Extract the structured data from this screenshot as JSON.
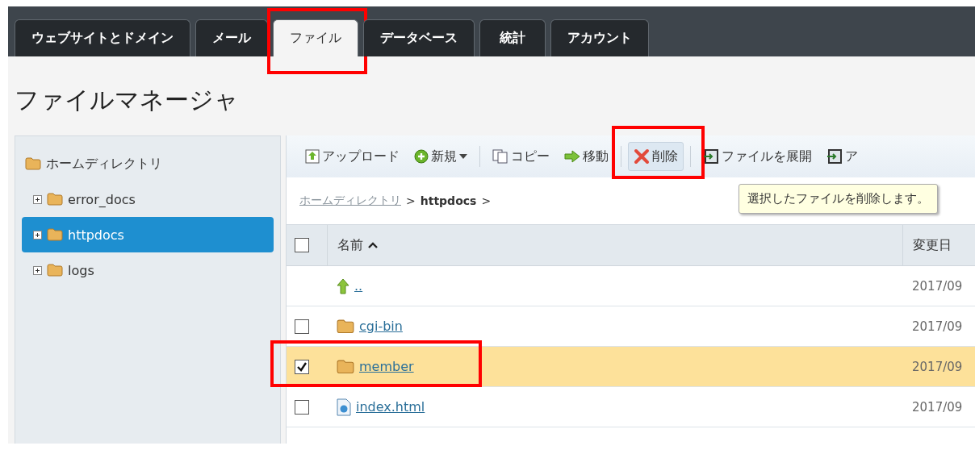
{
  "tabs": [
    {
      "label": "ウェブサイトとドメイン",
      "selected": false,
      "highlighted": false
    },
    {
      "label": "メール",
      "selected": false,
      "highlighted": false
    },
    {
      "label": "ファイル",
      "selected": true,
      "highlighted": true
    },
    {
      "label": "データベース",
      "selected": false,
      "highlighted": false
    },
    {
      "label": "統計",
      "selected": false,
      "highlighted": false
    },
    {
      "label": "アカウント",
      "selected": false,
      "highlighted": false
    }
  ],
  "page_title": "ファイルマネージャ",
  "tree": {
    "label": "ホームディレクトリ",
    "children": [
      {
        "label": "error_docs",
        "selected": false
      },
      {
        "label": "httpdocs",
        "selected": true
      },
      {
        "label": "logs",
        "selected": false
      }
    ]
  },
  "toolbar": [
    [
      {
        "kind": "upload",
        "label": "アップロード",
        "hovered": false,
        "highlighted": false
      },
      {
        "kind": "new",
        "label": "新規",
        "hovered": false,
        "highlighted": false
      }
    ],
    [
      {
        "kind": "copy",
        "label": "コピー",
        "hovered": false,
        "highlighted": false
      },
      {
        "kind": "move",
        "label": "移動",
        "hovered": false,
        "highlighted": false
      }
    ],
    [
      {
        "kind": "delete",
        "label": "削除",
        "hovered": true,
        "highlighted": true
      }
    ],
    [
      {
        "kind": "extract",
        "label": "ファイルを展開",
        "hovered": false,
        "highlighted": false
      },
      {
        "kind": "archive",
        "label": "ア",
        "hovered": false,
        "highlighted": false
      }
    ]
  ],
  "breadcrumb": {
    "separator": ">",
    "items": [
      {
        "label": "ホームディレクトリ",
        "link": true
      },
      {
        "label": "httpdocs",
        "link": false
      }
    ]
  },
  "tooltip": "選択したファイルを削除します。",
  "table": {
    "select_all": {
      "checked": false
    },
    "columns": [
      {
        "label": "名前",
        "sorted_ascending": true
      },
      {
        "label": "変更日",
        "sorted_ascending": false
      }
    ],
    "rows": [
      {
        "kind": "parent",
        "name": "..",
        "date": "2017/09"
      },
      {
        "kind": "folder",
        "name": "cgi-bin",
        "date": "2017/09",
        "checked": false,
        "highlighted": false
      },
      {
        "kind": "folder",
        "name": "member",
        "date": "2017/09",
        "checked": true,
        "highlighted": true
      },
      {
        "kind": "file",
        "name": "index.html",
        "date": "2017/09",
        "checked": false,
        "highlighted": false
      }
    ]
  }
}
